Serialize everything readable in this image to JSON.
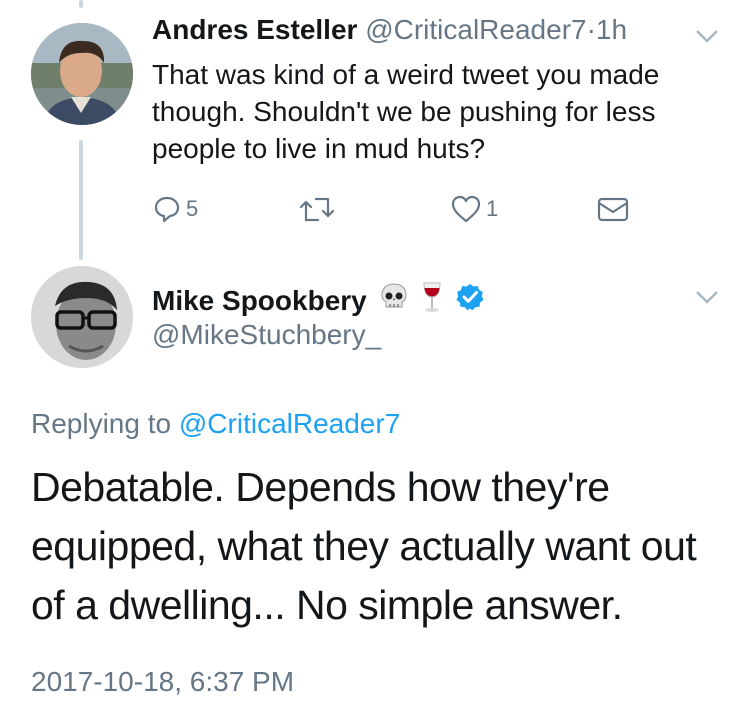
{
  "tweet1": {
    "name": "Andres Esteller",
    "handle": "@CriticalReader7",
    "separator": "·",
    "time": "1h",
    "text": "That was kind of a weird tweet you made though. Shouldn't we be pushing for less people to live in mud huts?",
    "reply_count": "5",
    "like_count": "1"
  },
  "tweet2": {
    "name": "Mike Spookbery",
    "handle": "@MikeStuchbery_",
    "emoji_skull": "💀",
    "emoji_wine": "🍷",
    "replying_prefix": "Replying to",
    "replying_handle": "@CriticalReader7",
    "text": "Debatable. Depends how they're equipped, what they actually want out of a dwelling... No simple answer.",
    "timestamp": "2017-10-18, 6:37 PM"
  },
  "colors": {
    "accent": "#1da1f2",
    "muted": "#657786",
    "thread_line": "#ccd6dd",
    "verified": "#1da1f2"
  },
  "icons": [
    "reply-icon",
    "retweet-icon",
    "heart-icon",
    "dm-envelope-icon",
    "chevron-down-icon",
    "verified-badge-icon"
  ]
}
